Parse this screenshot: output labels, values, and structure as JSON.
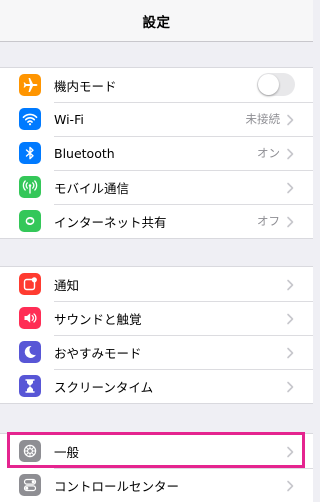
{
  "header": {
    "title": "設定"
  },
  "groups": [
    {
      "items": [
        {
          "label": "機内モード",
          "icon": "airplane-icon",
          "icon_color": "#ff9500",
          "control": "toggle",
          "toggle_on": false
        },
        {
          "label": "Wi-Fi",
          "icon": "wifi-icon",
          "icon_color": "#007aff",
          "value": "未接続"
        },
        {
          "label": "Bluetooth",
          "icon": "bluetooth-icon",
          "icon_color": "#007aff",
          "value": "オン"
        },
        {
          "label": "モバイル通信",
          "icon": "cellular-antenna-icon",
          "icon_color": "#34c759",
          "value": ""
        },
        {
          "label": "インターネット共有",
          "icon": "personal-hotspot-icon",
          "icon_color": "#34c759",
          "value": "オフ"
        }
      ]
    },
    {
      "items": [
        {
          "label": "通知",
          "icon": "notifications-icon",
          "icon_color": "#ff3b30"
        },
        {
          "label": "サウンドと触覚",
          "icon": "speaker-icon",
          "icon_color": "#ff2d55"
        },
        {
          "label": "おやすみモード",
          "icon": "moon-icon",
          "icon_color": "#5856d6"
        },
        {
          "label": "スクリーンタイム",
          "icon": "hourglass-icon",
          "icon_color": "#5856d6"
        }
      ]
    },
    {
      "items": [
        {
          "label": "一般",
          "icon": "gear-icon",
          "icon_color": "#8e8e93",
          "highlighted": true
        },
        {
          "label": "コントロールセンター",
          "icon": "toggles-icon",
          "icon_color": "#8e8e93"
        }
      ]
    }
  ],
  "colors": {
    "highlight_border": "#e5248f",
    "background": "#efeff4",
    "chevron": "#c7c7cc"
  }
}
